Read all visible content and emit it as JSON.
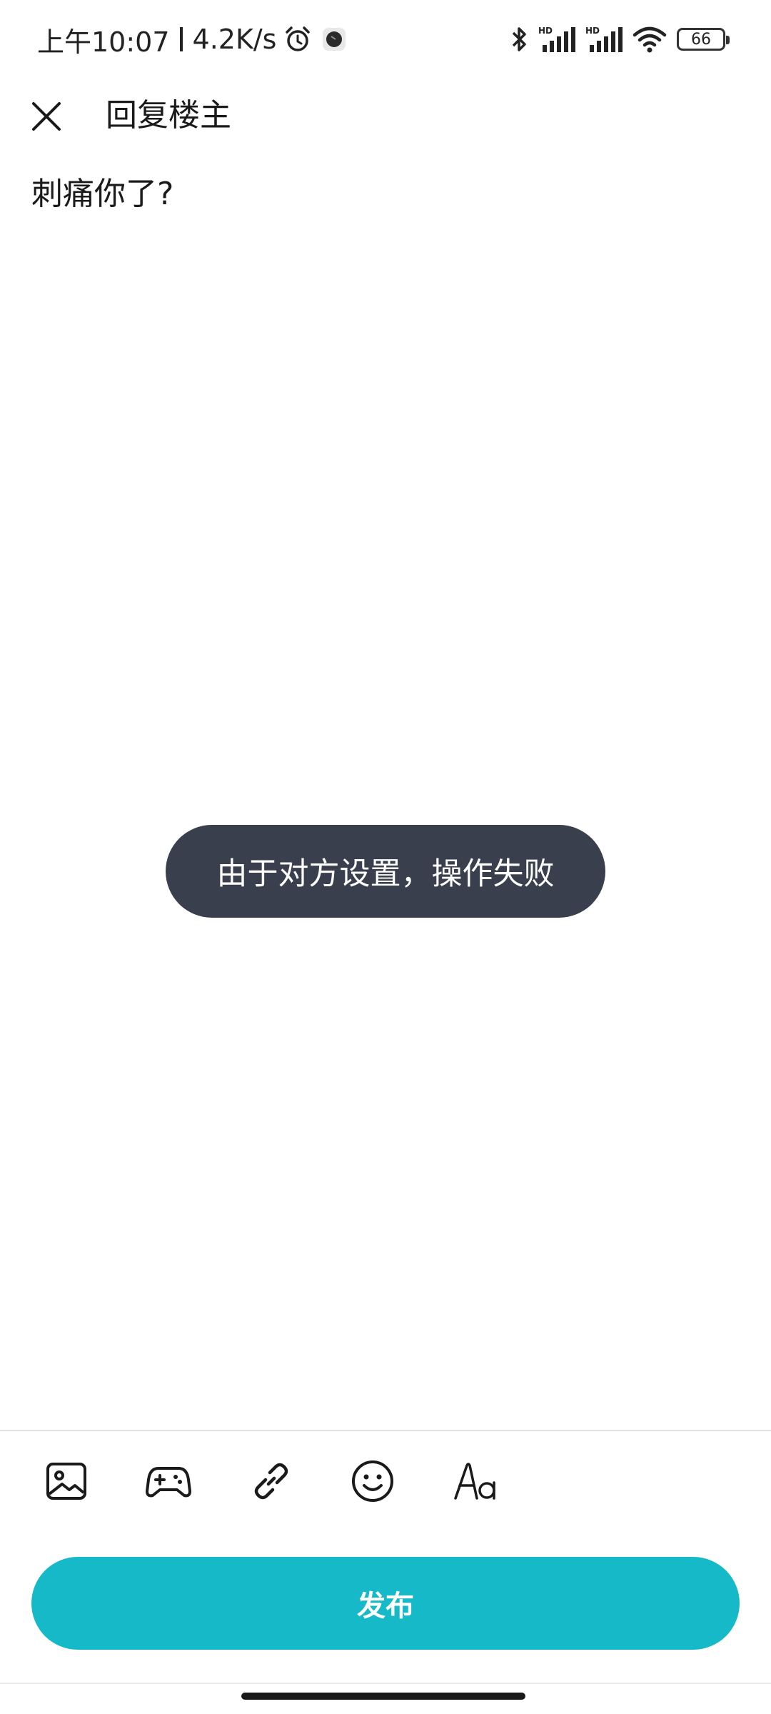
{
  "status_bar": {
    "time": "上午10:07",
    "net_speed": "4.2K/s",
    "battery": "66",
    "icons": [
      "alarm-icon",
      "app-notification-icon",
      "bluetooth-icon",
      "hd-signal-icon",
      "hd-signal-icon",
      "wifi-icon",
      "battery-icon"
    ]
  },
  "header": {
    "title": "回复楼主",
    "close_icon": "close-icon"
  },
  "editor": {
    "content": "刺痛你了?"
  },
  "toast": {
    "message": "由于对方设置，操作失败"
  },
  "toolbar": {
    "tools": [
      {
        "icon": "image-icon"
      },
      {
        "icon": "game-controller-icon"
      },
      {
        "icon": "link-icon"
      },
      {
        "icon": "emoji-icon"
      },
      {
        "icon": "text-format-icon"
      }
    ]
  },
  "publish": {
    "label": "发布",
    "color": "#16b9c7"
  },
  "colors": {
    "toast_bg": "#3a3f4d",
    "accent": "#16b9c7"
  }
}
